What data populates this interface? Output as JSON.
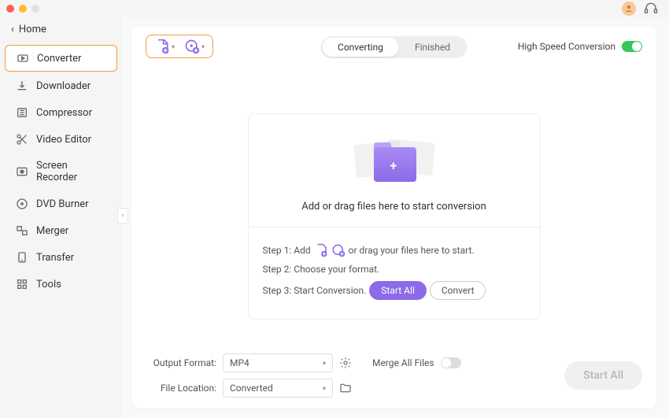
{
  "home": "Home",
  "sidebar": {
    "items": [
      {
        "label": "Converter"
      },
      {
        "label": "Downloader"
      },
      {
        "label": "Compressor"
      },
      {
        "label": "Video Editor"
      },
      {
        "label": "Screen Recorder"
      },
      {
        "label": "DVD Burner"
      },
      {
        "label": "Merger"
      },
      {
        "label": "Transfer"
      },
      {
        "label": "Tools"
      }
    ]
  },
  "tabs": {
    "converting": "Converting",
    "finished": "Finished"
  },
  "hsc_label": "High Speed Conversion",
  "dropzone": {
    "text": "Add or drag files here to start conversion",
    "step1_a": "Step 1: Add",
    "step1_b": "or drag your files here to start.",
    "step2": "Step 2: Choose your format.",
    "step3": "Step 3: Start Conversion.",
    "start_all": "Start  All",
    "convert": "Convert"
  },
  "footer": {
    "output_format_label": "Output Format:",
    "output_format_value": "MP4",
    "file_location_label": "File Location:",
    "file_location_value": "Converted",
    "merge_label": "Merge All Files",
    "start_all": "Start All"
  }
}
